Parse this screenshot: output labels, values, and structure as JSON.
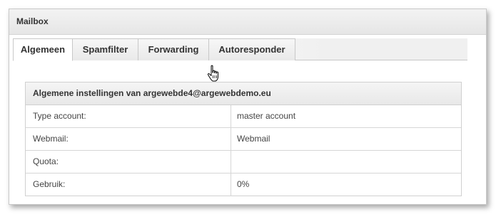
{
  "window": {
    "title": "Mailbox"
  },
  "tabs": [
    {
      "label": "Algemeen",
      "active": true
    },
    {
      "label": "Spamfilter",
      "active": false
    },
    {
      "label": "Forwarding",
      "active": false,
      "hovered": true
    },
    {
      "label": "Autoresponder",
      "active": false
    }
  ],
  "panel": {
    "title": "Algemene instellingen van argewebde4@argewebdemo.eu",
    "rows": [
      {
        "label": "Type account:",
        "value": "master account"
      },
      {
        "label": "Webmail:",
        "value": "Webmail"
      },
      {
        "label": "Quota:",
        "value": ""
      },
      {
        "label": "Gebruik:",
        "value": "0%"
      }
    ]
  },
  "cursor": {
    "icon": "hand-pointer-icon"
  }
}
